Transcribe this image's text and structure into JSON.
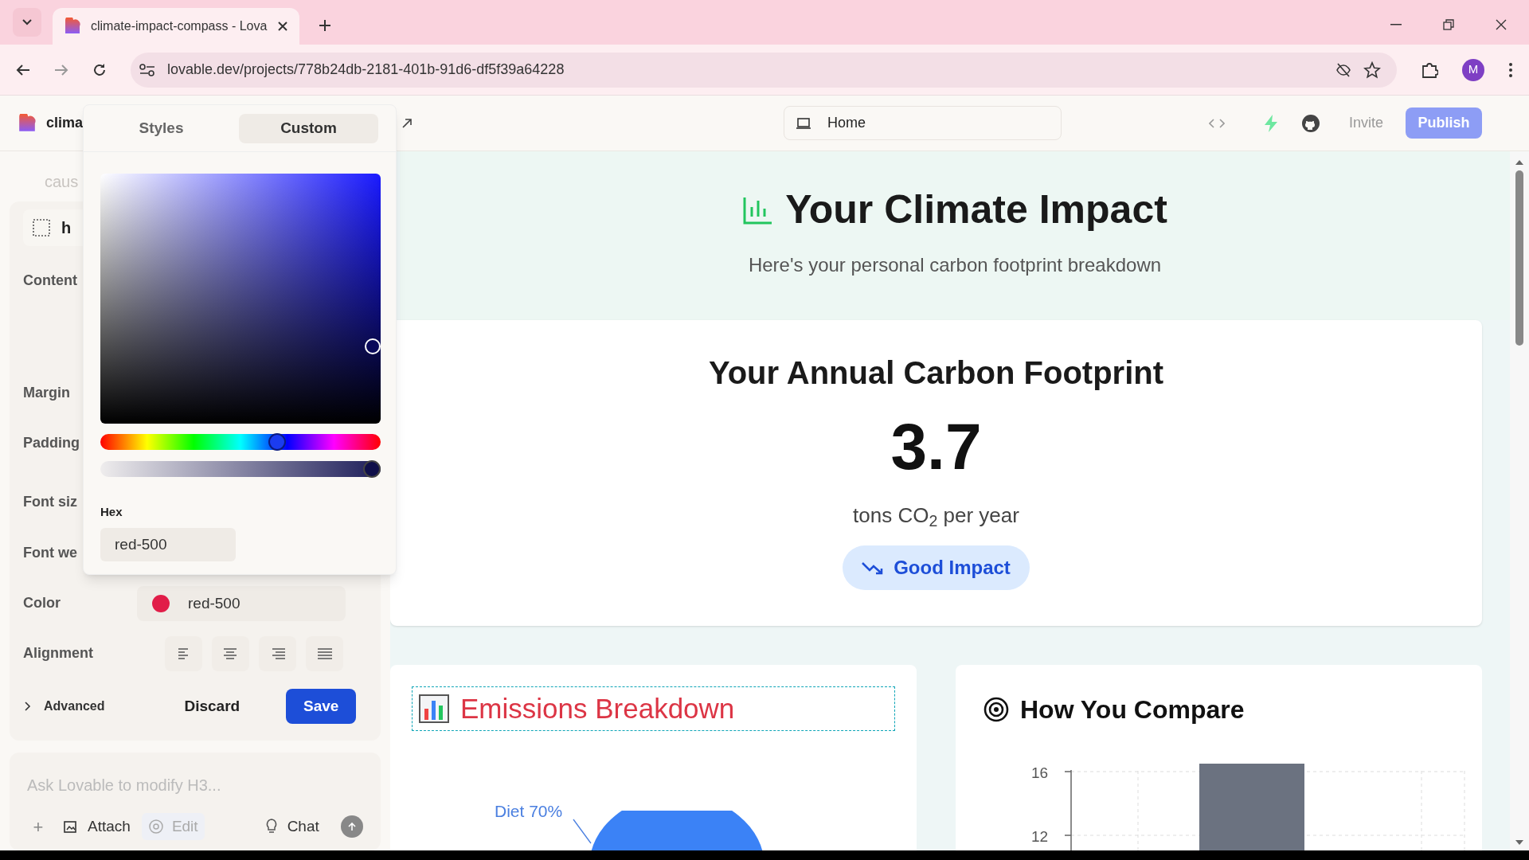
{
  "browser": {
    "tab_title": "climate-impact-compass - Lova",
    "url": "lovable.dev/projects/778b24db-2181-401b-91d6-df5f39a64228",
    "profile_initial": "M"
  },
  "app_header": {
    "project_name": "clima",
    "page_selector": "Home",
    "invite": "Invite",
    "publish": "Publish"
  },
  "sidebar": {
    "faded_text": "caus",
    "selected_element": "h",
    "properties": [
      "Content",
      "Margin",
      "Padding",
      "Font siz",
      "Font we"
    ],
    "color": {
      "label": "Color",
      "value": "red-500"
    },
    "alignment": {
      "label": "Alignment",
      "options": [
        {
          "kind": "left"
        },
        {
          "kind": "center"
        },
        {
          "kind": "right"
        },
        {
          "kind": "justify"
        }
      ]
    },
    "advanced": {
      "label": "Advanced",
      "expanded": false
    },
    "discard": "Discard",
    "save": "Save"
  },
  "chat": {
    "placeholder": "Ask Lovable to modify H3...",
    "actions": [
      {
        "kind": "add",
        "label": "+"
      },
      {
        "kind": "attach",
        "label": "Attach"
      },
      {
        "kind": "edit",
        "label": "Edit"
      },
      {
        "kind": "chat",
        "label": "Chat"
      }
    ]
  },
  "color_popover": {
    "tabs": [
      {
        "label": "Styles",
        "selected": false
      },
      {
        "label": "Custom",
        "selected": true
      }
    ],
    "hue": {
      "level": 0.63
    },
    "alpha": {
      "level": 0.97
    },
    "hex_label": "Hex",
    "hex_value": "red-500"
  },
  "preview": {
    "title": "Your Climate Impact",
    "subtitle": "Here's your personal carbon footprint breakdown",
    "footprint": {
      "heading": "Your Annual Carbon Footprint",
      "value": "3.7",
      "unit": "tons CO$_{2}$ per year",
      "badge": "Good Impact"
    },
    "breakdown": {
      "title": "Emissions Breakdown",
      "pie_label": "Diet 70%"
    },
    "compare": {
      "title": "How You Compare",
      "y_ticks": [
        "16",
        "12"
      ]
    }
  }
}
